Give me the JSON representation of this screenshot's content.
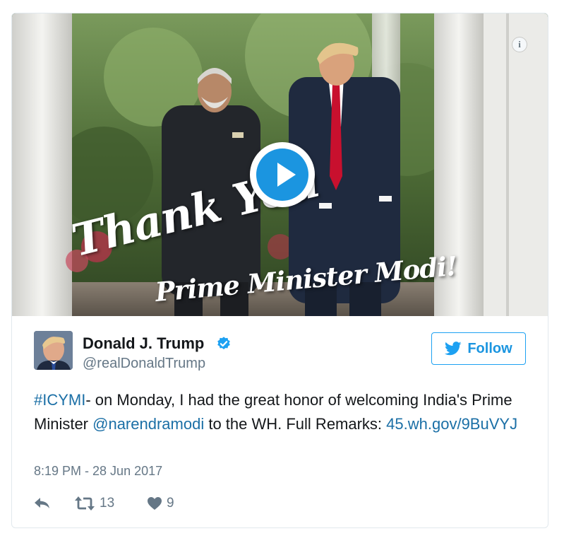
{
  "media": {
    "overlay_title": "Thank You",
    "overlay_subtitle": "Prime Minister Modi!",
    "info_icon": "info-icon",
    "play_icon": "play-icon"
  },
  "user": {
    "name": "Donald J. Trump",
    "handle": "@realDonaldTrump",
    "verified_icon": "verified-badge-icon"
  },
  "follow_button": {
    "label": "Follow",
    "icon": "twitter-bird-icon"
  },
  "tweet": {
    "hashtag": "#ICYMI",
    "text_part1": "- on Monday, I had the great honor of welcoming India's Prime Minister ",
    "mention": "@narendramodi",
    "text_part2": " to the WH. Full Remarks: ",
    "link": "45.wh.gov/9BuVYJ",
    "timestamp": "8:19 PM - 28 Jun 2017"
  },
  "actions": {
    "reply_icon": "reply-icon",
    "retweet_icon": "retweet-icon",
    "retweet_count": "13",
    "like_icon": "heart-icon",
    "like_count": "9"
  },
  "colors": {
    "accent": "#1da1f2",
    "link": "#1b6fa6",
    "muted": "#657786",
    "border": "#e1e8ed"
  }
}
